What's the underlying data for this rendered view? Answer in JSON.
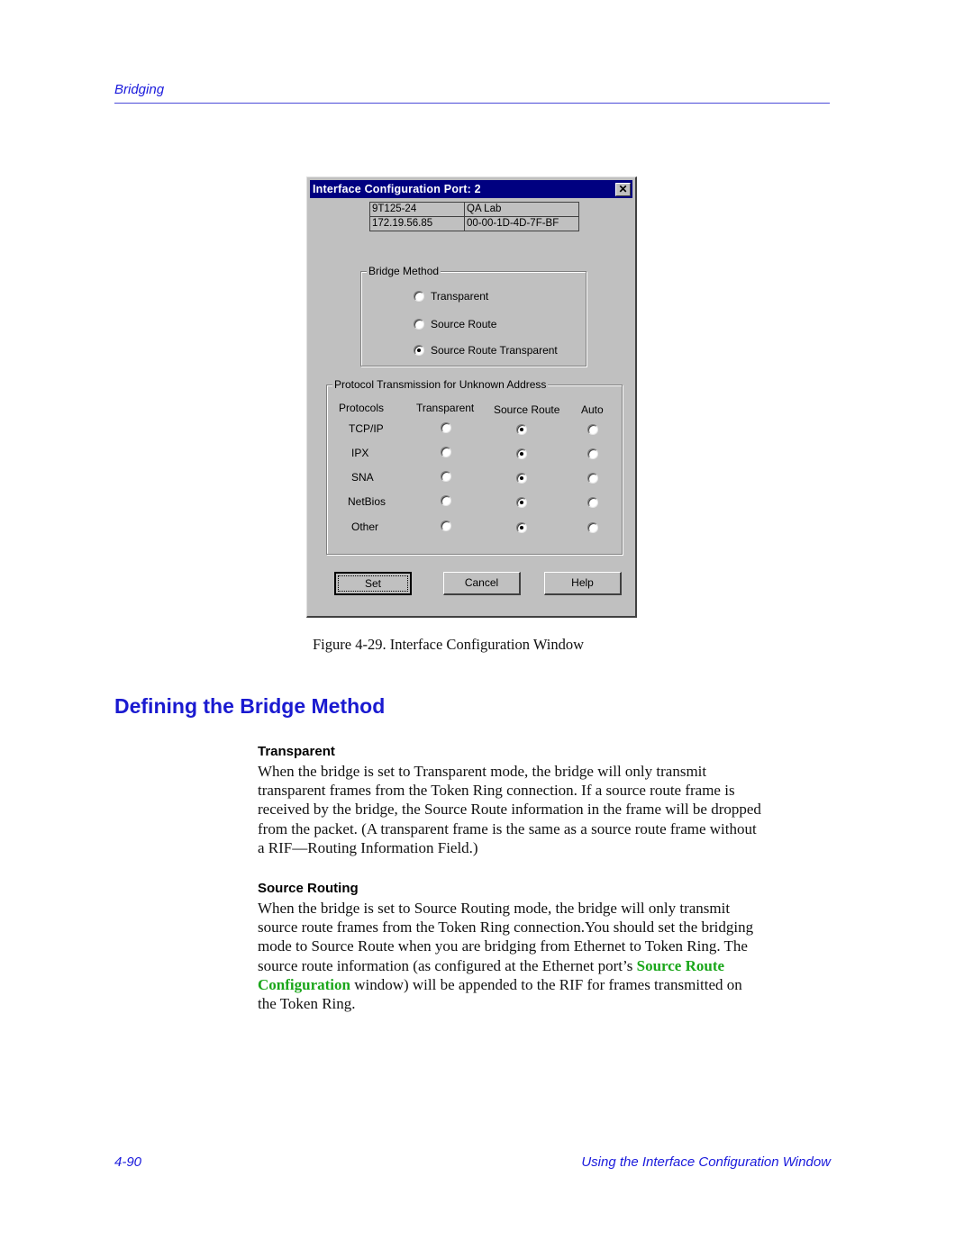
{
  "running_head": "Bridging",
  "dialog": {
    "title": "Interface Configuration Port: 2",
    "close_glyph": "✕",
    "info": {
      "rows": [
        [
          "9T125-24",
          "QA Lab"
        ],
        [
          "172.19.56.85",
          "00-00-1D-4D-7F-BF"
        ]
      ]
    },
    "bridge_method": {
      "label": "Bridge Method",
      "options": [
        {
          "label": "Transparent",
          "checked": false
        },
        {
          "label": "Source Route",
          "checked": false
        },
        {
          "label": "Source Route Transparent",
          "checked": true
        }
      ]
    },
    "protocol_transmission": {
      "label": "Protocol Transmission for Unknown Address",
      "columns": [
        "Protocols",
        "Transparent",
        "Source Route",
        "Auto"
      ],
      "rows": [
        {
          "protocol": "TCP/IP",
          "selected": "Source Route"
        },
        {
          "protocol": "IPX",
          "selected": "Source Route"
        },
        {
          "protocol": "SNA",
          "selected": "Source Route"
        },
        {
          "protocol": "NetBios",
          "selected": "Source Route"
        },
        {
          "protocol": "Other",
          "selected": "Source Route"
        }
      ]
    },
    "buttons": {
      "set": "Set",
      "cancel": "Cancel",
      "help": "Help"
    }
  },
  "caption": "Figure 4-29.  Interface Configuration Window",
  "section_title": "Defining the Bridge Method",
  "transparent": {
    "heading": "Transparent",
    "lines": [
      "When the bridge is set to Transparent mode, the bridge will only transmit",
      "transparent frames from the Token Ring connection. If a source route frame is",
      "received by the bridge, the Source Route information in the frame will be dropped",
      "from the packet. (A transparent frame is the same as a source route frame without",
      "a RIF—Routing Information Field.)"
    ]
  },
  "source_routing": {
    "heading": "Source Routing",
    "line1": "When the bridge is set to Source Routing mode, the bridge will only transmit",
    "line2": "source route frames from the Token Ring connection.You should set the bridging",
    "line3": "mode to Source Route when you are bridging from Ethernet to Token Ring. The",
    "line4_pre": "source route information (as configured at the Ethernet port’s ",
    "link_part1": "Source Route",
    "link_part2": "Configuration",
    "line5_post": " window) will be appended to the RIF for frames transmitted on",
    "line6": "the Token Ring."
  },
  "footer": {
    "page_number": "4-90",
    "chapter_title": "Using the Interface Configuration Window"
  },
  "colors": {
    "heading_blue": "#1a1ad0",
    "titlebar": "#000080",
    "dialog_face": "#c0c0c0",
    "xref_green": "#1aa61a"
  }
}
